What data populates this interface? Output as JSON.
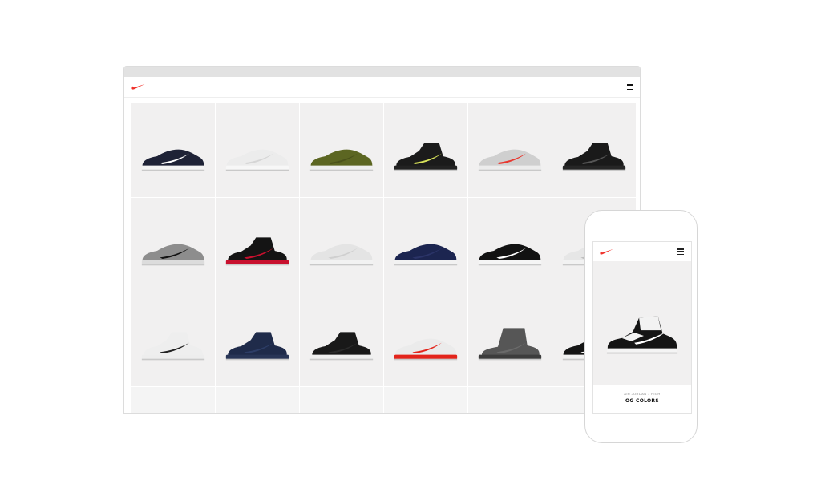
{
  "brand": {
    "accent": "#f0302a"
  },
  "desktop": {
    "icons": {
      "logo": "swoosh-logo",
      "menu": "hamburger-menu-icon"
    },
    "products": [
      {
        "name": "navy-swoosh-runner",
        "upper": "#1e2236",
        "sole": "#f4f4f4",
        "accent": "#ffffff",
        "style": "low"
      },
      {
        "name": "white-huarache",
        "upper": "#ececec",
        "sole": "#f7f7f7",
        "accent": "#d5d5d5",
        "style": "low"
      },
      {
        "name": "olive-roshe",
        "upper": "#5c6622",
        "sole": "#efefef",
        "accent": "#4a521a",
        "style": "low"
      },
      {
        "name": "black-jordan-12",
        "upper": "#1b1b1b",
        "sole": "#222222",
        "accent": "#d8e35a",
        "style": "mid"
      },
      {
        "name": "infrared-air-max-90",
        "upper": "#cfcfcf",
        "sole": "#ececec",
        "accent": "#e8372f",
        "style": "low"
      },
      {
        "name": "black-jordan-4",
        "upper": "#1a1a1a",
        "sole": "#262626",
        "accent": "#555555",
        "style": "mid"
      },
      {
        "name": "grey-flyknit-racer",
        "upper": "#8d8d8d",
        "sole": "#dcdcdc",
        "accent": "#111111",
        "style": "low"
      },
      {
        "name": "bred-jordan-11",
        "upper": "#141414",
        "sole": "#c8102e",
        "accent": "#c8102e",
        "style": "mid"
      },
      {
        "name": "white-air-max-90",
        "upper": "#e4e4e4",
        "sole": "#f2f2f2",
        "accent": "#cfcfcf",
        "style": "low"
      },
      {
        "name": "navy-huarache",
        "upper": "#1c2550",
        "sole": "#f2f2f2",
        "accent": "#2b3468",
        "style": "low"
      },
      {
        "name": "black-cortez",
        "upper": "#121212",
        "sole": "#f5f5f5",
        "accent": "#ffffff",
        "style": "low"
      },
      {
        "name": "white-runner-partial",
        "upper": "#e6e6e6",
        "sole": "#f2f2f2",
        "accent": "#bdbdbd",
        "style": "low"
      },
      {
        "name": "white-cement-jordan-4",
        "upper": "#eeeeee",
        "sole": "#ededed",
        "accent": "#222222",
        "style": "mid"
      },
      {
        "name": "navy-trainer-mid",
        "upper": "#1f2b4a",
        "sole": "#283556",
        "accent": "#2d3d66",
        "style": "mid"
      },
      {
        "name": "black-trainer-mid",
        "upper": "#191919",
        "sole": "#f0f0f0",
        "accent": "#2a2a2a",
        "style": "mid"
      },
      {
        "name": "red-air-max-1",
        "upper": "#ebebeb",
        "sole": "#e3241b",
        "accent": "#e3241b",
        "style": "low"
      },
      {
        "name": "grey-high-boot",
        "upper": "#565656",
        "sole": "#3c3c3c",
        "accent": "#6a6a6a",
        "style": "boot"
      },
      {
        "name": "black-white-partial",
        "upper": "#151515",
        "sole": "#f2f2f2",
        "accent": "#ffffff",
        "style": "low"
      }
    ]
  },
  "mobile": {
    "icons": {
      "logo": "swoosh-logo",
      "menu": "hamburger-menu-icon"
    },
    "product": {
      "name": "black-white-jordan-1",
      "upper": "#151515",
      "sole": "#f4f4f4",
      "accent": "#ffffff"
    },
    "subtitle": "AIR JORDAN 1 HIGH",
    "title": "OG COLORS"
  }
}
